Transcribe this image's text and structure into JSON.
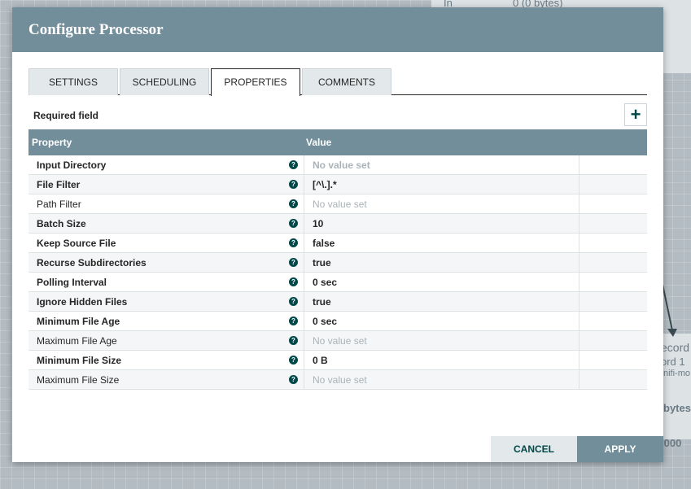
{
  "background": {
    "top_label": "In",
    "top_value": "0 (0 bytes)",
    "right_texts": [
      "ecord",
      "ord 1",
      "nifi-mo",
      "bytes",
      ".000"
    ]
  },
  "dialog": {
    "title": "Configure Processor",
    "tabs": [
      {
        "label": "SETTINGS",
        "active": false
      },
      {
        "label": "SCHEDULING",
        "active": false
      },
      {
        "label": "PROPERTIES",
        "active": true
      },
      {
        "label": "COMMENTS",
        "active": false
      }
    ],
    "required_field_label": "Required field",
    "add_button_label": "+",
    "grid": {
      "headers": {
        "property": "Property",
        "value": "Value"
      },
      "help_glyph": "?",
      "rows": [
        {
          "name": "Input Directory",
          "value": "No value set",
          "required": true,
          "unset": true
        },
        {
          "name": "File Filter",
          "value": "[^\\.].*",
          "required": true,
          "unset": false
        },
        {
          "name": "Path Filter",
          "value": "No value set",
          "required": false,
          "unset": true
        },
        {
          "name": "Batch Size",
          "value": "10",
          "required": true,
          "unset": false
        },
        {
          "name": "Keep Source File",
          "value": "false",
          "required": true,
          "unset": false
        },
        {
          "name": "Recurse Subdirectories",
          "value": "true",
          "required": true,
          "unset": false
        },
        {
          "name": "Polling Interval",
          "value": "0 sec",
          "required": true,
          "unset": false
        },
        {
          "name": "Ignore Hidden Files",
          "value": "true",
          "required": true,
          "unset": false
        },
        {
          "name": "Minimum File Age",
          "value": "0 sec",
          "required": true,
          "unset": false
        },
        {
          "name": "Maximum File Age",
          "value": "No value set",
          "required": false,
          "unset": true
        },
        {
          "name": "Minimum File Size",
          "value": "0 B",
          "required": true,
          "unset": false
        },
        {
          "name": "Maximum File Size",
          "value": "No value set",
          "required": false,
          "unset": true
        }
      ]
    },
    "buttons": {
      "cancel": "CANCEL",
      "apply": "APPLY"
    }
  },
  "colors": {
    "header": "#728e9b",
    "accent": "#004849",
    "tab_bg": "#e3e8eb"
  }
}
